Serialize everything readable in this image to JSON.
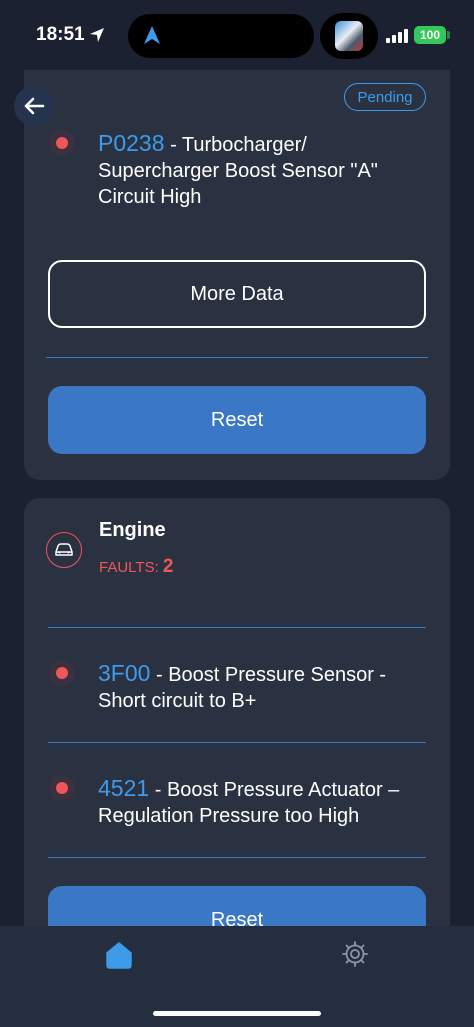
{
  "status_bar": {
    "time": "18:51",
    "battery": "100",
    "icons": [
      "location-arrow-icon",
      "navigation-icon",
      "app-thumbnail",
      "signal-icon",
      "battery-icon"
    ]
  },
  "colors": {
    "background": "#1b2130",
    "card": "#2a3242",
    "accent_blue": "#3d9be9",
    "button_blue": "#3a78c6",
    "fault_red": "#f0555a",
    "battery_green": "#34c759"
  },
  "header": {
    "back_icon": "arrow-left-icon",
    "pending_label": "Pending"
  },
  "card1": {
    "fault": {
      "code": "P0238",
      "description": " - Turbocharger/ Supercharger Boost Sensor \"A\" Circuit High"
    },
    "more_data_label": "More Data",
    "reset_label": "Reset"
  },
  "card2": {
    "module_icon": "car-icon",
    "module_title": "Engine",
    "faults_label": "FAULTS: ",
    "faults_count": "2",
    "faults": [
      {
        "code": "3F00",
        "description": " - Boost Pressure Sensor -Short circuit to B+"
      },
      {
        "code": "4521",
        "description": " - Boost Pressure Actuator – Regulation Pressure too High"
      }
    ],
    "reset_label": "Reset"
  },
  "tab_bar": {
    "items": [
      {
        "icon": "home-icon",
        "active": true
      },
      {
        "icon": "gear-icon",
        "active": false
      }
    ]
  }
}
